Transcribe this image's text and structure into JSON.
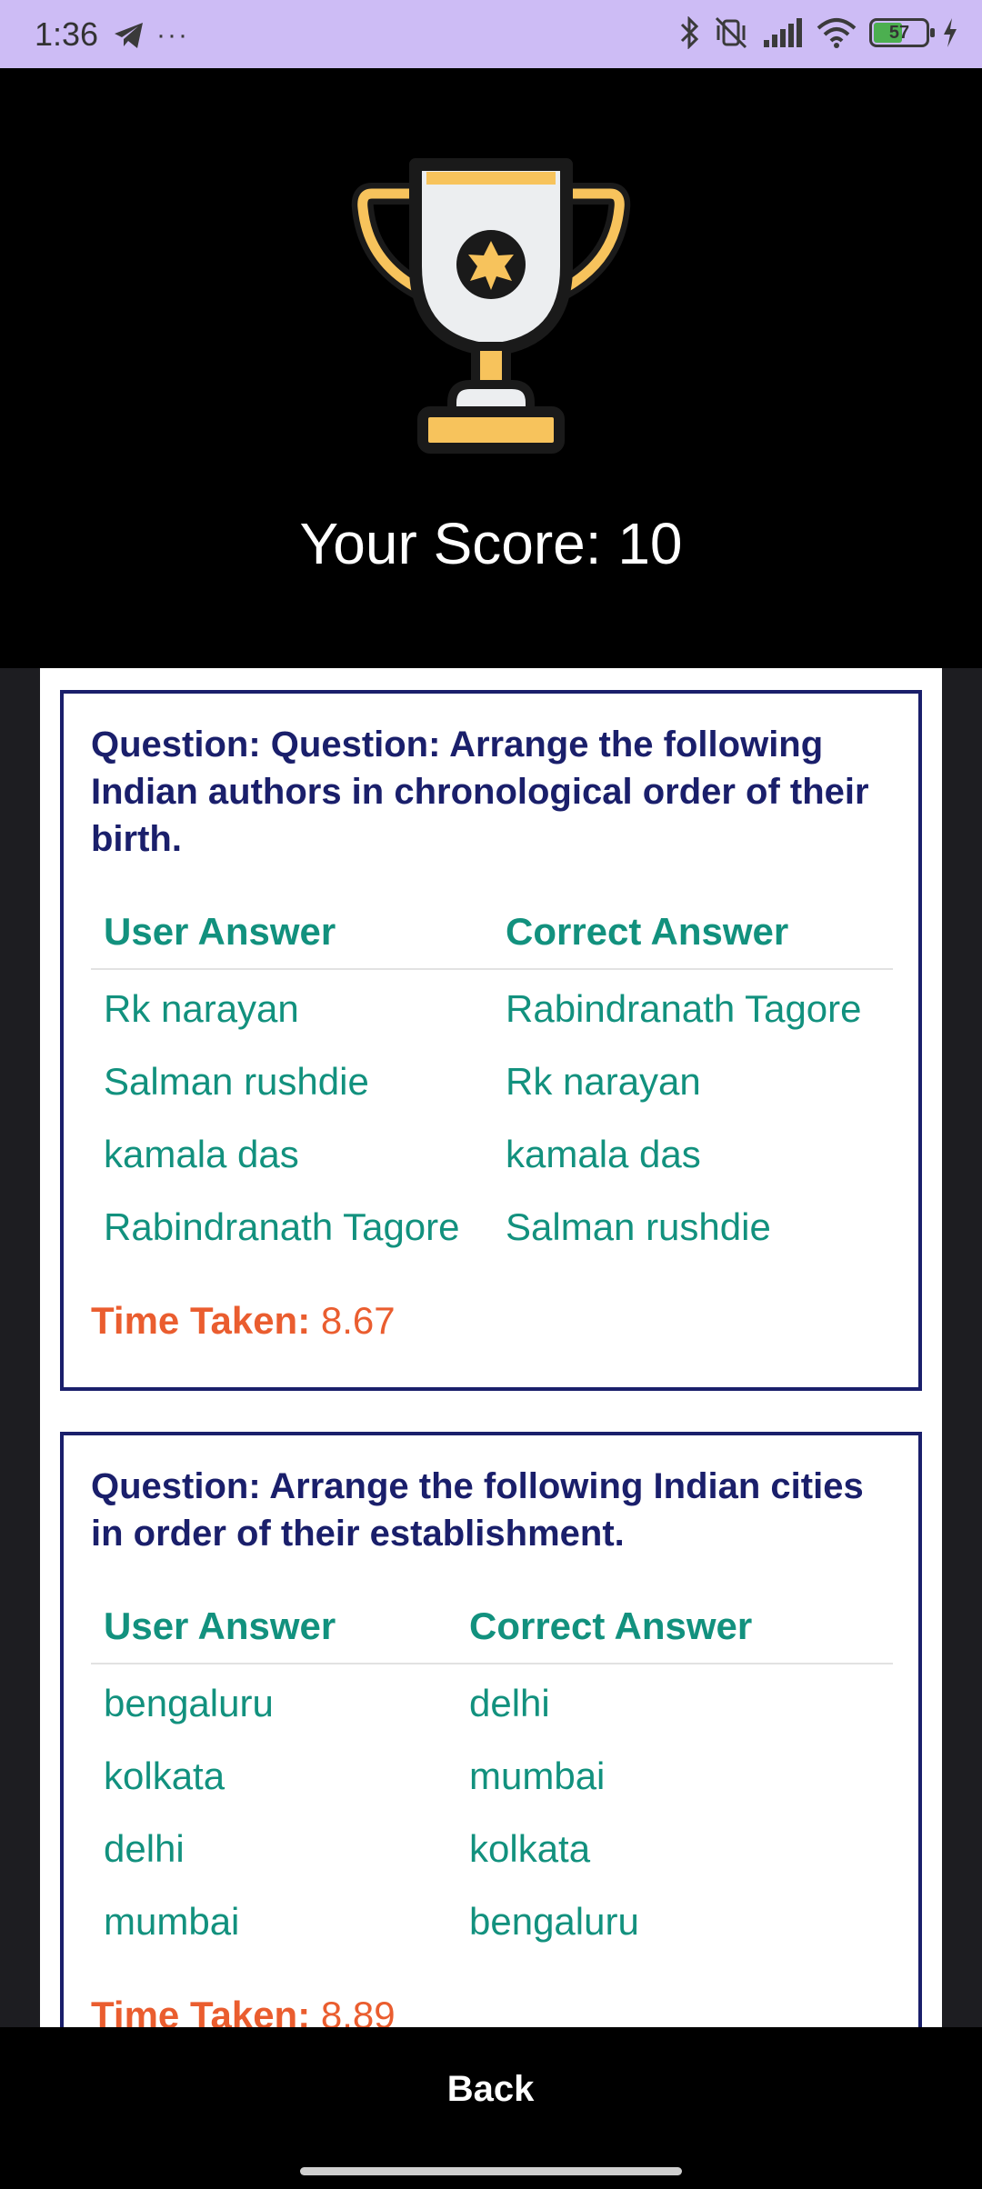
{
  "status_bar": {
    "time": "1:36",
    "more": "···",
    "battery": "57",
    "icons": [
      "telegram-icon",
      "bluetooth-icon",
      "vibrate-off-icon",
      "signal-icon",
      "wifi-icon",
      "battery-icon",
      "charging-icon"
    ]
  },
  "result": {
    "score_text": "Your Score: 10"
  },
  "answers_header": {
    "user": "User Answer",
    "correct": "Correct Answer"
  },
  "questions": [
    {
      "text": "Question: Question: Arrange the following Indian authors in chronological order of their birth.",
      "rows": [
        {
          "user": "Rk narayan",
          "correct": "Rabindranath Tagore"
        },
        {
          "user": "Salman rushdie",
          "correct": "Rk narayan"
        },
        {
          "user": "kamala das",
          "correct": "kamala das"
        },
        {
          "user": "Rabindranath Tagore",
          "correct": "Salman rushdie"
        }
      ],
      "time_label": "Time Taken:",
      "time_value": "8.67"
    },
    {
      "text": "Question: Arrange the following Indian cities in order of their establishment.",
      "rows": [
        {
          "user": "bengaluru",
          "correct": "delhi"
        },
        {
          "user": "kolkata",
          "correct": "mumbai"
        },
        {
          "user": "delhi",
          "correct": "kolkata"
        },
        {
          "user": "mumbai",
          "correct": "bengaluru"
        }
      ],
      "time_label": "Time Taken:",
      "time_value": "8.89"
    }
  ],
  "back_label": "Back",
  "colors": {
    "question": "#1a1f6b",
    "answer": "#12917e",
    "time": "#ea5d2f",
    "trophy_gold": "#f7c35c",
    "status_bar": "#cdbcf5"
  }
}
